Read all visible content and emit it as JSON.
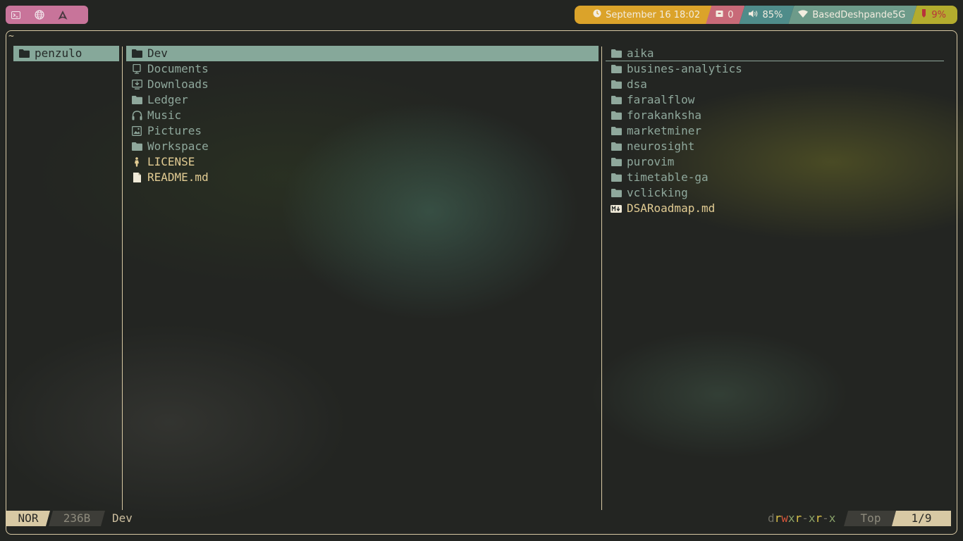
{
  "topbar": {
    "launcher": {
      "icons": [
        "terminal-icon",
        "globe-icon",
        "arch-icon"
      ]
    },
    "status": {
      "datetime": "September 16 18:02",
      "updates": "0",
      "volume": "85%",
      "wifi": "BasedDeshpande5G",
      "battery": "9%"
    },
    "colors": {
      "launcher": "#c8749a",
      "clock": "#dba32a",
      "updates": "#c86a78",
      "volume": "#4f8c8a",
      "wifi": "#6d9b8a",
      "battery": "#b3ac2e"
    }
  },
  "fm": {
    "path": "~",
    "parent": [
      {
        "name": "penzulo",
        "icon": "folder-icon",
        "selected": true
      }
    ],
    "current": [
      {
        "name": "Dev",
        "icon": "folder-icon",
        "selected": true
      },
      {
        "name": "Documents",
        "icon": "document-icon"
      },
      {
        "name": "Downloads",
        "icon": "download-icon"
      },
      {
        "name": "Ledger",
        "icon": "folder-icon"
      },
      {
        "name": "Music",
        "icon": "headphones-icon"
      },
      {
        "name": "Pictures",
        "icon": "picture-icon"
      },
      {
        "name": "Workspace",
        "icon": "folder-icon"
      },
      {
        "name": "LICENSE",
        "icon": "license-icon",
        "file": true
      },
      {
        "name": "README.md",
        "icon": "file-icon",
        "file": true
      }
    ],
    "preview": [
      {
        "name": "aika",
        "icon": "folder-icon"
      },
      {
        "name": "busines-analytics",
        "icon": "folder-icon"
      },
      {
        "name": "dsa",
        "icon": "folder-icon"
      },
      {
        "name": "faraalflow",
        "icon": "folder-icon"
      },
      {
        "name": "forakanksha",
        "icon": "folder-icon"
      },
      {
        "name": "marketminer",
        "icon": "folder-icon"
      },
      {
        "name": "neurosight",
        "icon": "folder-icon"
      },
      {
        "name": "purovim",
        "icon": "folder-icon"
      },
      {
        "name": "timetable-ga",
        "icon": "folder-icon"
      },
      {
        "name": "vclicking",
        "icon": "folder-icon"
      },
      {
        "name": "DSARoadmap.md",
        "icon": "markdown-icon",
        "file": true
      }
    ],
    "statusline": {
      "mode": "NOR",
      "size": "236B",
      "name": "Dev",
      "perm_d": "d",
      "perm_r1": "r",
      "perm_w1": "w",
      "perm_x1": "x",
      "perm_r2": "r",
      "perm_n2": "-",
      "perm_x2": "x",
      "perm_r3": "r",
      "perm_n3": "-",
      "perm_x3": "x",
      "position": "Top",
      "count": "1/9"
    }
  }
}
